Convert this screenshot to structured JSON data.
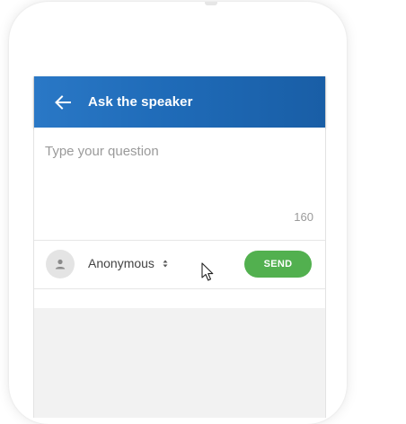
{
  "header": {
    "title": "Ask the speaker",
    "back_icon": "arrow-left-icon"
  },
  "compose": {
    "placeholder": "Type your question",
    "char_count": "160"
  },
  "actions": {
    "identity": "Anonymous",
    "identity_icon": "user-avatar-icon",
    "send_label": "SEND"
  },
  "colors": {
    "header": "#1f6bb8",
    "send": "#52b04f",
    "background": "#f2f2f2"
  }
}
